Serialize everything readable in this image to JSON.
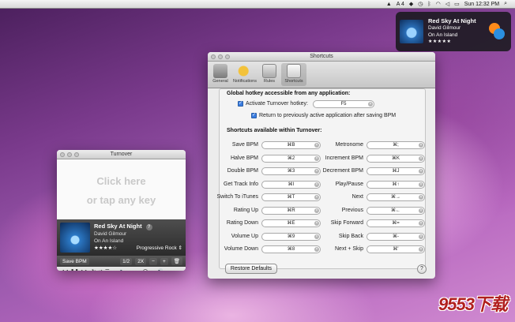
{
  "menubar": {
    "status_text": "A 4",
    "clock": "Sun 12:32 PM",
    "icons": [
      "adobe-icon",
      "dropbox-icon",
      "time-machine-icon",
      "bluetooth-icon",
      "wifi-icon",
      "volume-icon",
      "battery-icon",
      "search-icon"
    ]
  },
  "notification": {
    "title": "Red Sky At Night",
    "artist": "David Gilmour",
    "album": "On An Island",
    "stars": "★★★★★"
  },
  "turnover": {
    "title": "Turnover",
    "drop_line1": "Click here",
    "drop_line2": "or tap any key",
    "track_name": "Red Sky At Night",
    "track_help": "?",
    "artist": "David Gilmour",
    "album": "On An Island",
    "rating": "★★★★☆",
    "genre": "Progressive Rock",
    "save_bpm": "Save BPM",
    "half": "1/2",
    "double": "2X",
    "minus": "−",
    "plus": "+",
    "trash": "🗑",
    "transport": {
      "back": "◀◀",
      "pause": "❚❚",
      "forward": "▶▶",
      "repeat": "↻",
      "shuffle": "⇄",
      "menu": "☰",
      "airplay": "▭",
      "vol_low": "🔈",
      "vol_high": "🔊"
    },
    "volume_level": 0.7
  },
  "prefs": {
    "title": "Shortcuts",
    "tabs": [
      {
        "label": "General",
        "icon": "general-icon"
      },
      {
        "label": "Notifications",
        "icon": "megaphone-icon"
      },
      {
        "label": "Rules",
        "icon": "rules-icon"
      },
      {
        "label": "Shortcuts",
        "icon": "keyboard-icon"
      }
    ],
    "global_title": "Global hotkey accessible from any application:",
    "activate_label": "Activate Turnover hotkey:",
    "activate_value": "F5",
    "return_label": "Return to previously active application after saving BPM",
    "within_title": "Shortcuts available within Turnover:",
    "left_shortcuts": [
      {
        "label": "Save BPM",
        "key": "⌘B"
      },
      {
        "label": "Halve BPM",
        "key": "⌘2"
      },
      {
        "label": "Double BPM",
        "key": "⌘3"
      },
      {
        "label": "Get Track Info",
        "key": "⌘I"
      },
      {
        "label": "Switch To iTunes",
        "key": "⌘T"
      },
      {
        "label": "Rating Up",
        "key": "⌘R"
      },
      {
        "label": "Rating Down",
        "key": "⌘E"
      },
      {
        "label": "Volume Up",
        "key": "⌘9"
      },
      {
        "label": "Volume Down",
        "key": "⌘8"
      }
    ],
    "right_shortcuts": [
      {
        "label": "Metronome",
        "key": "⌘;"
      },
      {
        "label": "Increment BPM",
        "key": "⌘K"
      },
      {
        "label": "Decrement BPM",
        "key": "⌘J"
      },
      {
        "label": "Play/Pause",
        "key": "⌘↑"
      },
      {
        "label": "Next",
        "key": "⌘→"
      },
      {
        "label": "Previous",
        "key": "⌘←"
      },
      {
        "label": "Skip Forward",
        "key": "⌘="
      },
      {
        "label": "Skip Back",
        "key": "⌘-"
      },
      {
        "label": "Next + Skip",
        "key": "⌘'"
      }
    ],
    "restore_label": "Restore Defaults",
    "help_label": "?"
  },
  "watermark": "9553下载"
}
